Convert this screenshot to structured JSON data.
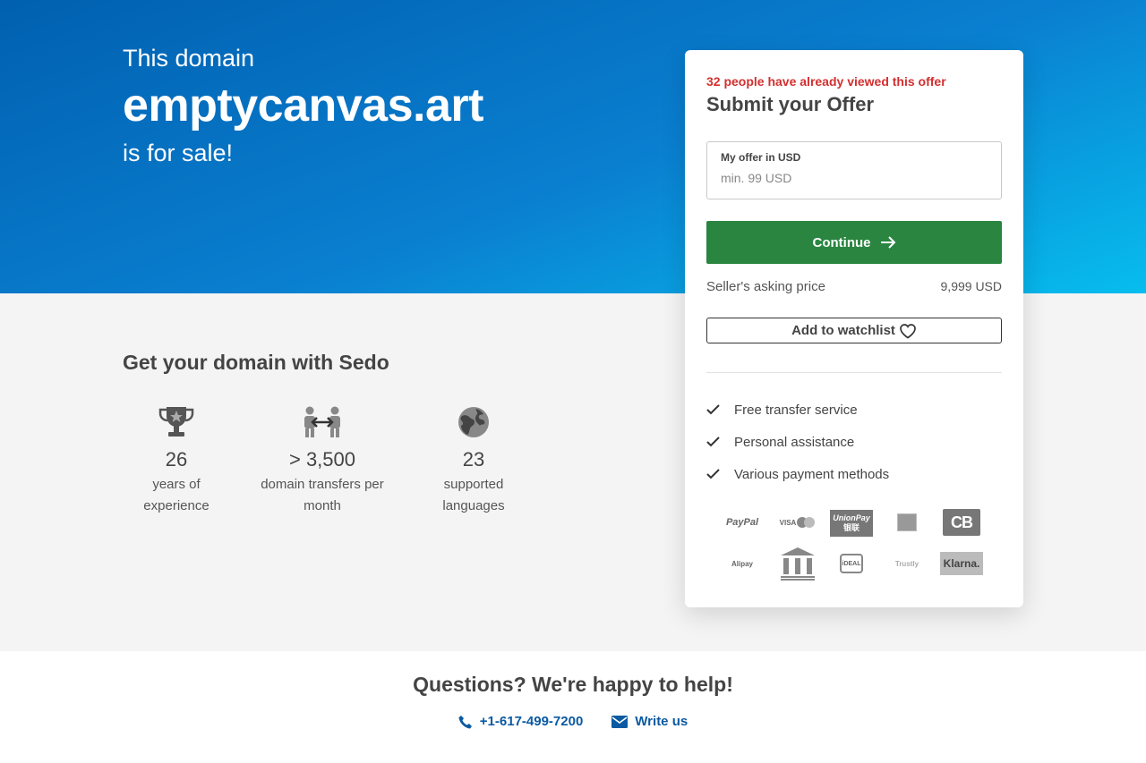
{
  "hero": {
    "pre": "This domain",
    "domain": "emptycanvas.art",
    "post": "is for sale!"
  },
  "colors": {
    "accent_green": "#2a8540",
    "alert_red": "#d32f2f",
    "link_blue": "#0b5aa2",
    "hero_start": "#0160b0",
    "hero_end": "#07bdee"
  },
  "features": {
    "title": "Get your domain with Sedo",
    "items": [
      {
        "icon": "trophy-icon",
        "number": "26",
        "label": "years of experience"
      },
      {
        "icon": "transfer-icon",
        "number": "> 3,500",
        "label": "domain transfers per month"
      },
      {
        "icon": "globe-icon",
        "number": "23",
        "label": "supported languages"
      }
    ]
  },
  "offer": {
    "views_notice": "32 people have already viewed this offer",
    "title": "Submit your Offer",
    "input_label": "My offer in USD",
    "input_placeholder": "min. 99 USD",
    "input_value": "",
    "continue_label": "Continue",
    "asking_label": "Seller's asking price",
    "asking_price": "9,999 USD",
    "watchlist_label": "Add to watchlist",
    "benefits": [
      "Free transfer service",
      "Personal assistance",
      "Various payment methods"
    ]
  },
  "payments": {
    "paypal": "PayPal",
    "visa": "VISA",
    "unionpay": "UnionPay",
    "unionpay_cn": "银联",
    "cb": "CB",
    "alipay": "Alipay",
    "ideal": "iDEAL",
    "trustly": "Trustly",
    "klarna": "Klarna."
  },
  "help": {
    "title": "Questions? We're happy to help!",
    "phone": "+1-617-499-7200",
    "write": "Write us"
  }
}
